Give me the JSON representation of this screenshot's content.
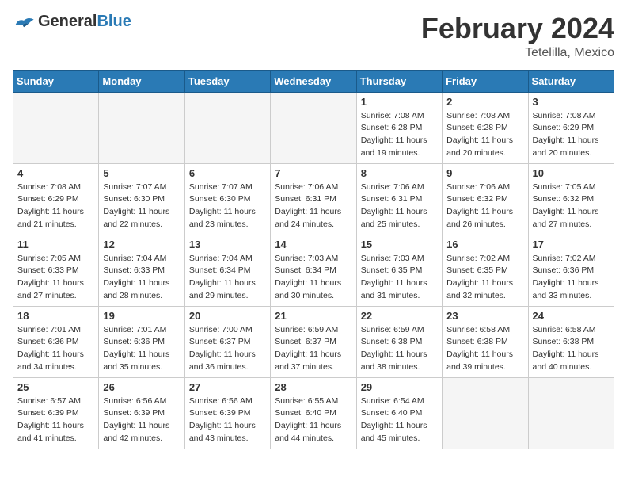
{
  "header": {
    "logo_general": "General",
    "logo_blue": "Blue",
    "month_title": "February 2024",
    "location": "Tetelilla, Mexico"
  },
  "days_of_week": [
    "Sunday",
    "Monday",
    "Tuesday",
    "Wednesday",
    "Thursday",
    "Friday",
    "Saturday"
  ],
  "weeks": [
    [
      {
        "day": "",
        "empty": true
      },
      {
        "day": "",
        "empty": true
      },
      {
        "day": "",
        "empty": true
      },
      {
        "day": "",
        "empty": true
      },
      {
        "day": "1",
        "sunrise": "7:08 AM",
        "sunset": "6:28 PM",
        "daylight": "11 hours and 19 minutes."
      },
      {
        "day": "2",
        "sunrise": "7:08 AM",
        "sunset": "6:28 PM",
        "daylight": "11 hours and 20 minutes."
      },
      {
        "day": "3",
        "sunrise": "7:08 AM",
        "sunset": "6:29 PM",
        "daylight": "11 hours and 20 minutes."
      }
    ],
    [
      {
        "day": "4",
        "sunrise": "7:08 AM",
        "sunset": "6:29 PM",
        "daylight": "11 hours and 21 minutes."
      },
      {
        "day": "5",
        "sunrise": "7:07 AM",
        "sunset": "6:30 PM",
        "daylight": "11 hours and 22 minutes."
      },
      {
        "day": "6",
        "sunrise": "7:07 AM",
        "sunset": "6:30 PM",
        "daylight": "11 hours and 23 minutes."
      },
      {
        "day": "7",
        "sunrise": "7:06 AM",
        "sunset": "6:31 PM",
        "daylight": "11 hours and 24 minutes."
      },
      {
        "day": "8",
        "sunrise": "7:06 AM",
        "sunset": "6:31 PM",
        "daylight": "11 hours and 25 minutes."
      },
      {
        "day": "9",
        "sunrise": "7:06 AM",
        "sunset": "6:32 PM",
        "daylight": "11 hours and 26 minutes."
      },
      {
        "day": "10",
        "sunrise": "7:05 AM",
        "sunset": "6:32 PM",
        "daylight": "11 hours and 27 minutes."
      }
    ],
    [
      {
        "day": "11",
        "sunrise": "7:05 AM",
        "sunset": "6:33 PM",
        "daylight": "11 hours and 27 minutes."
      },
      {
        "day": "12",
        "sunrise": "7:04 AM",
        "sunset": "6:33 PM",
        "daylight": "11 hours and 28 minutes."
      },
      {
        "day": "13",
        "sunrise": "7:04 AM",
        "sunset": "6:34 PM",
        "daylight": "11 hours and 29 minutes."
      },
      {
        "day": "14",
        "sunrise": "7:03 AM",
        "sunset": "6:34 PM",
        "daylight": "11 hours and 30 minutes."
      },
      {
        "day": "15",
        "sunrise": "7:03 AM",
        "sunset": "6:35 PM",
        "daylight": "11 hours and 31 minutes."
      },
      {
        "day": "16",
        "sunrise": "7:02 AM",
        "sunset": "6:35 PM",
        "daylight": "11 hours and 32 minutes."
      },
      {
        "day": "17",
        "sunrise": "7:02 AM",
        "sunset": "6:36 PM",
        "daylight": "11 hours and 33 minutes."
      }
    ],
    [
      {
        "day": "18",
        "sunrise": "7:01 AM",
        "sunset": "6:36 PM",
        "daylight": "11 hours and 34 minutes."
      },
      {
        "day": "19",
        "sunrise": "7:01 AM",
        "sunset": "6:36 PM",
        "daylight": "11 hours and 35 minutes."
      },
      {
        "day": "20",
        "sunrise": "7:00 AM",
        "sunset": "6:37 PM",
        "daylight": "11 hours and 36 minutes."
      },
      {
        "day": "21",
        "sunrise": "6:59 AM",
        "sunset": "6:37 PM",
        "daylight": "11 hours and 37 minutes."
      },
      {
        "day": "22",
        "sunrise": "6:59 AM",
        "sunset": "6:38 PM",
        "daylight": "11 hours and 38 minutes."
      },
      {
        "day": "23",
        "sunrise": "6:58 AM",
        "sunset": "6:38 PM",
        "daylight": "11 hours and 39 minutes."
      },
      {
        "day": "24",
        "sunrise": "6:58 AM",
        "sunset": "6:38 PM",
        "daylight": "11 hours and 40 minutes."
      }
    ],
    [
      {
        "day": "25",
        "sunrise": "6:57 AM",
        "sunset": "6:39 PM",
        "daylight": "11 hours and 41 minutes."
      },
      {
        "day": "26",
        "sunrise": "6:56 AM",
        "sunset": "6:39 PM",
        "daylight": "11 hours and 42 minutes."
      },
      {
        "day": "27",
        "sunrise": "6:56 AM",
        "sunset": "6:39 PM",
        "daylight": "11 hours and 43 minutes."
      },
      {
        "day": "28",
        "sunrise": "6:55 AM",
        "sunset": "6:40 PM",
        "daylight": "11 hours and 44 minutes."
      },
      {
        "day": "29",
        "sunrise": "6:54 AM",
        "sunset": "6:40 PM",
        "daylight": "11 hours and 45 minutes."
      },
      {
        "day": "",
        "empty": true
      },
      {
        "day": "",
        "empty": true
      }
    ]
  ]
}
